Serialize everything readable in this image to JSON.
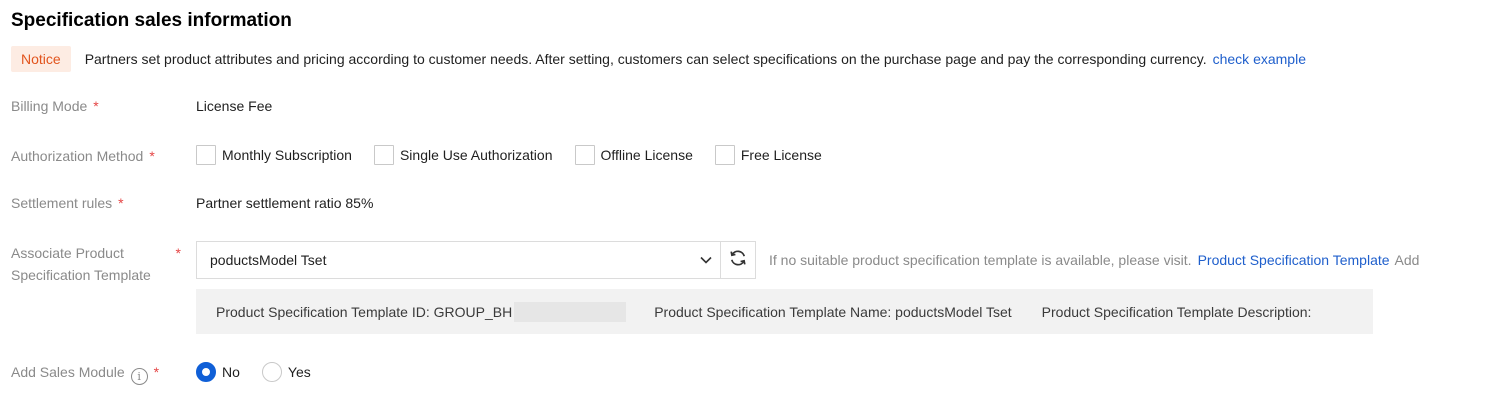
{
  "section": {
    "title": "Specification sales information"
  },
  "notice": {
    "tag": "Notice",
    "text": "Partners set product attributes and pricing according to customer needs. After setting, customers can select specifications on the purchase page and pay the corresponding currency.",
    "link": "check example"
  },
  "billing": {
    "label": "Billing Mode",
    "required_mark": "*",
    "value": "License Fee"
  },
  "authorization": {
    "label": "Authorization Method",
    "required_mark": "*",
    "options": [
      {
        "label": "Monthly Subscription",
        "checked": false
      },
      {
        "label": "Single Use Authorization",
        "checked": false
      },
      {
        "label": "Offline License",
        "checked": false
      },
      {
        "label": "Free License",
        "checked": false
      }
    ]
  },
  "settlement": {
    "label": "Settlement rules",
    "required_mark": "*",
    "value": "Partner settlement ratio 85%"
  },
  "template": {
    "label_line1": "Associate Product",
    "label_line2": "Specification Template",
    "required_mark": "*",
    "selected": "poductsModel Tset",
    "hint": "If no suitable product specification template is available, please visit.",
    "hint_link": "Product Specification Template",
    "hint_suffix": "Add",
    "info": {
      "id": "Product Specification Template ID: GROUP_BH",
      "name": "Product Specification Template Name: poductsModel Tset",
      "description": "Product Specification Template Description:"
    }
  },
  "sales_module": {
    "label": "Add Sales Module",
    "required_mark": "*",
    "info_icon": "i",
    "options": [
      {
        "label": "No",
        "checked": true
      },
      {
        "label": "Yes",
        "checked": false
      }
    ]
  },
  "colors": {
    "accent": "#0f5fd7",
    "link": "#1f5fcc",
    "notice_bg": "#fdece3",
    "notice_text": "#e2541d",
    "required": "#e54545"
  }
}
